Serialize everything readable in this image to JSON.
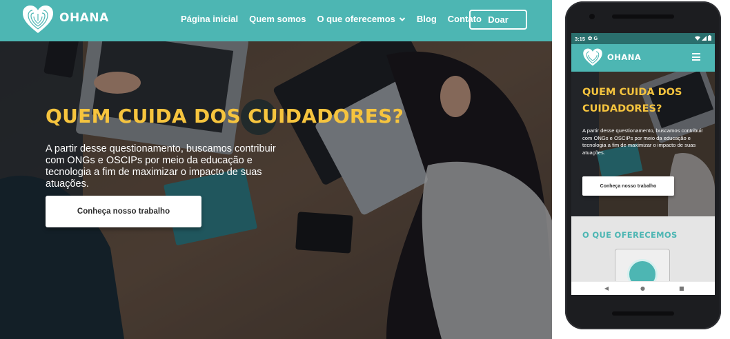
{
  "brand": {
    "name": "OHANA",
    "teal": "#4db6b3",
    "yellow": "#f6c43e"
  },
  "desktop": {
    "nav": {
      "items": [
        {
          "label": "Página inicial"
        },
        {
          "label": "Quem somos"
        },
        {
          "label": "O que oferecemos",
          "has_dropdown": true
        },
        {
          "label": "Blog"
        },
        {
          "label": "Contato"
        }
      ],
      "donate_label": "Doar"
    },
    "hero": {
      "title": "QUEM CUIDA DOS CUIDADORES?",
      "text": "A partir desse questionamento, buscamos contribuir com ONGs e OSCIPs por meio da educação e tecnologia a fim de maximizar o impacto de suas atuações.",
      "cta_label": "Conheça nosso trabalho"
    }
  },
  "phone": {
    "status": {
      "time": "3:15",
      "left_icons": "✿ G"
    },
    "hero": {
      "title": "QUEM CUIDA DOS CUIDADORES?",
      "text": "A partir desse questionamento, buscamos contribuir com ONGs e OSCIPs por meio da educação e tecnologia a fim de maximizar o impacto de suas atuações.",
      "cta_label": "Conheça nosso trabalho"
    },
    "section": {
      "title": "O QUE OFERECEMOS"
    },
    "system_nav": {
      "back": "◀",
      "home": "●",
      "recents": "■"
    }
  }
}
